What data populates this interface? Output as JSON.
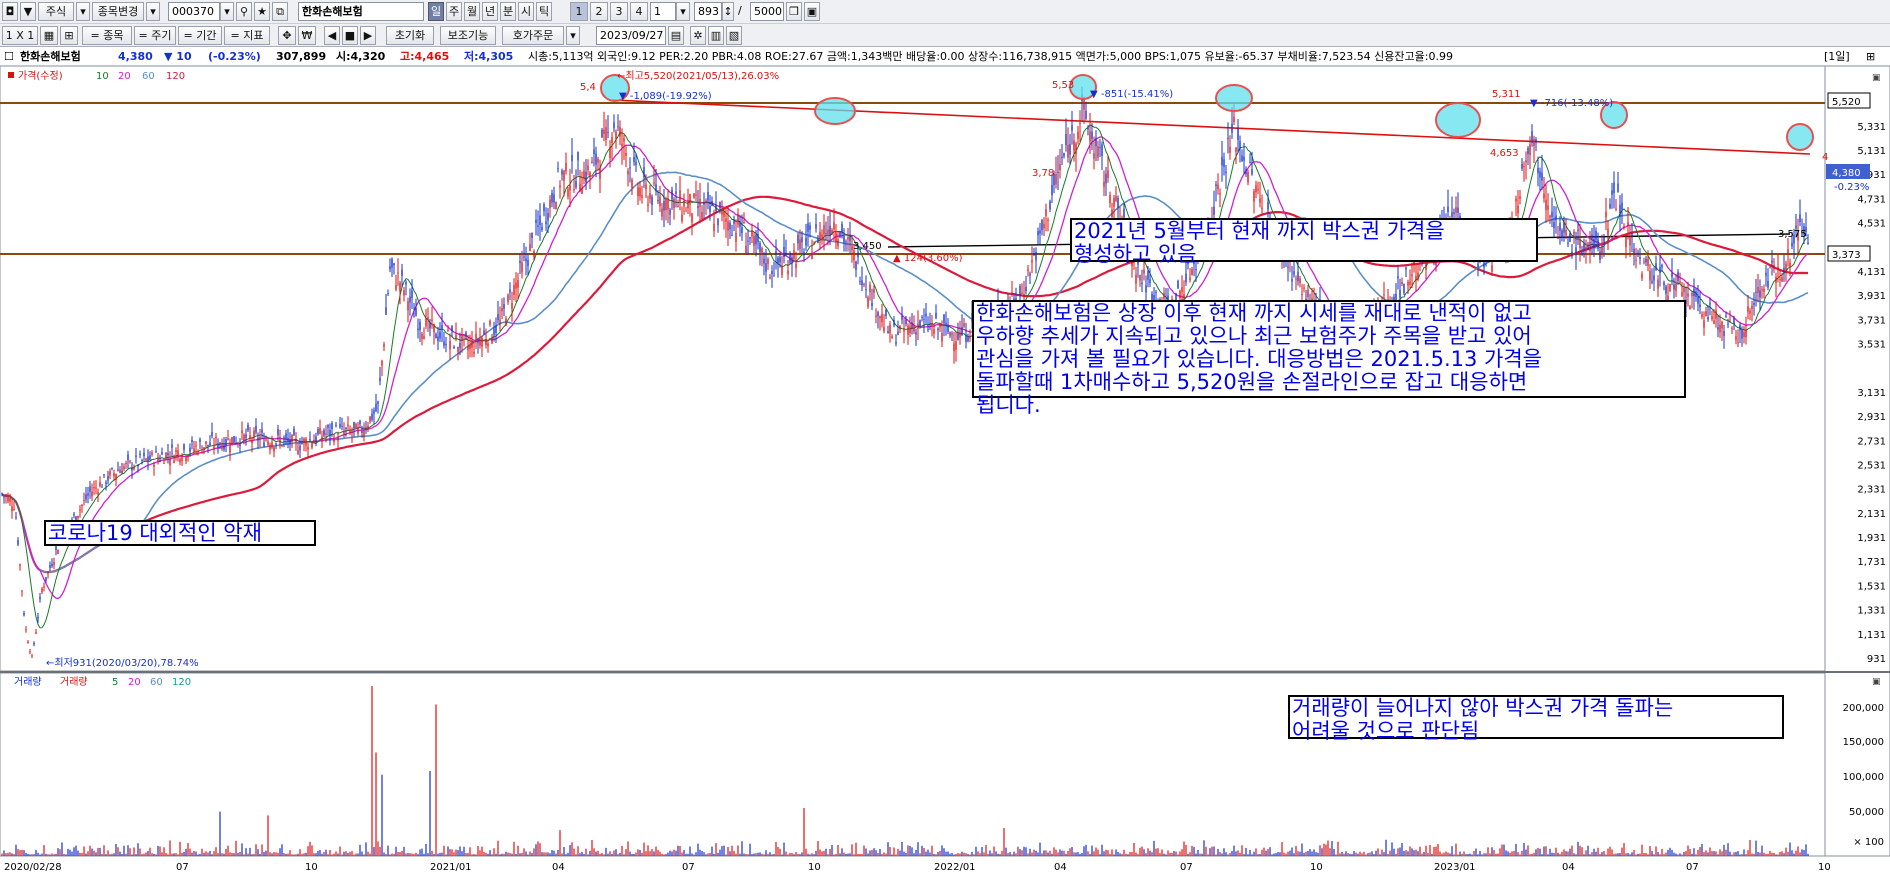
{
  "toolbar": {
    "market": "주식",
    "change_stock": "종목변경",
    "code": "000370",
    "stock_name": "한화손해보험",
    "periods": [
      "일",
      "주",
      "월",
      "년",
      "분",
      "시",
      "틱"
    ],
    "nums": [
      "1",
      "2",
      "3",
      "4",
      "1"
    ],
    "count": "893",
    "max": "5000",
    "row2": [
      "1 X 1",
      "= 종목",
      "= 주기",
      "= 기간",
      "= 지표"
    ],
    "reset": "초기화",
    "aux": "보조기능",
    "order": "호가주문",
    "date": "2023/09/27"
  },
  "info": {
    "name": "한화손해보험",
    "price": "4,380",
    "change": "▼ 10",
    "rate": "(-0.23%)",
    "volume": "307,899",
    "open": "시:4,320",
    "high": "고:4,465",
    "low": "저:4,305",
    "rest": "시총:5,113억  외국인:9.12  PER:2.20  PBR:4.08  ROE:27.67  금액:1,343백만  배당율:0.00  상장수:116,738,915  액면가:5,000  BPS:1,075  유보율:-65.37  부채비율:7,523.54  신용잔고율:0.99",
    "period": "[1일]"
  },
  "legend": {
    "price": "가격(수정)",
    "ma": [
      "10",
      "20",
      "60",
      "120"
    ],
    "vol": [
      "거래량",
      "거래량",
      "5",
      "20",
      "60",
      "120"
    ]
  },
  "colors": {
    "ma10": "#1a7a2a",
    "ma20": "#d020d0",
    "ma60": "#5a8fc8",
    "ma120": "#dd1a3a",
    "up": "#e01010",
    "down": "#1530d0"
  },
  "annotations": {
    "high": "←최고5,520(2021/05/13),26.03%",
    "low": "←최저931(2020/03/20),78.74%",
    "d1": "▼ -1,089(-19.92%)",
    "d2": "▼ -851(-15.41%)",
    "d3": "▼ -716(-13.48%)",
    "up1": "▲ 124(3.60%)",
    "p1": "5,4",
    "p2": "5,53",
    "p3": "5,311",
    "p4": "4,653",
    "p5": "3,78",
    "p6": "3,450",
    "p7": "3,575",
    "p8": "4"
  },
  "boxes": {
    "b1": "2021년 5월부터 현재 까지 박스권 가격을\n형성하고 있음",
    "b2": "한화손해보험은 상장 이후 현재 까지 시세를 재대로 낸적이 없고\n우하향 추세가 지속되고 있으나 최근 보험주가 주목을 받고 있어\n관심을 가져 볼 필요가 있습니다. 대응방법은 2021.5.13 가격을\n돌파할때 1차매수하고 5,520원을 손절라인으로 잡고 대응하면\n됩니다.",
    "b3": "코로나19 대외적인 악재",
    "b4": "거래량이 늘어나지 않아 박스권 가격 돌파는\n어려울 것으로 판단됨"
  },
  "price_axis": [
    "5,331",
    "5,131",
    "4,931",
    "4,731",
    "4,531",
    "4,131",
    "3,931",
    "3,731",
    "3,531",
    "3,131",
    "2,931",
    "2,731",
    "2,531",
    "2,331",
    "2,131",
    "1,931",
    "1,731",
    "1,531",
    "1,331",
    "1,131",
    "931"
  ],
  "price_tags": {
    "top": "5,520",
    "current": "4,380",
    "pct": "-0.23%",
    "bottom": "3,373"
  },
  "volume_axis": [
    "200,000",
    "150,000",
    "100,000",
    "50,000",
    "× 100"
  ],
  "date_axis": [
    "2020/02/28",
    "07",
    "10",
    "2021/01",
    "04",
    "07",
    "10",
    "2022/01",
    "04",
    "07",
    "10",
    "2023/01",
    "04",
    "07",
    "10"
  ]
}
